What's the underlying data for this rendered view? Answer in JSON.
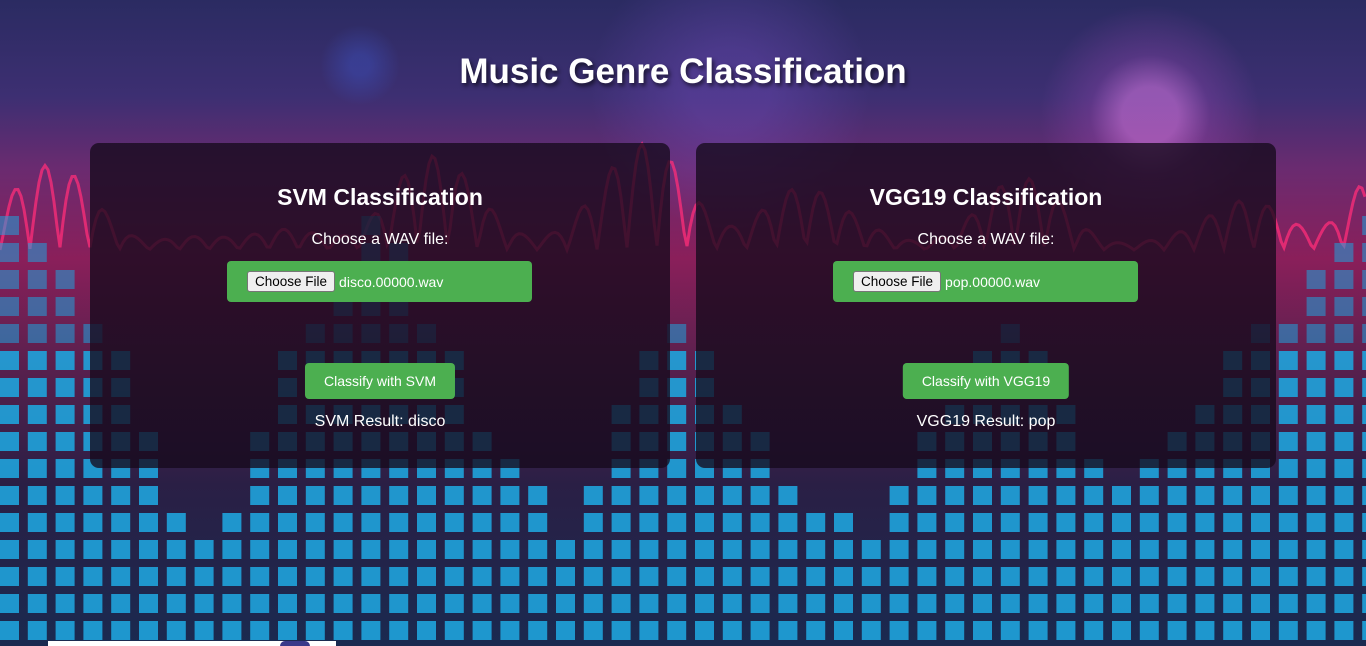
{
  "page": {
    "title": "Music Genre Classification"
  },
  "svm": {
    "heading": "SVM Classification",
    "choose_label": "Choose a WAV file:",
    "file_button": "Choose File",
    "file_name": "disco.00000.wav",
    "classify_button": "Classify with SVM",
    "result": "SVM Result: disco"
  },
  "vgg": {
    "heading": "VGG19 Classification",
    "choose_label": "Choose a WAV file:",
    "file_button": "Choose File",
    "file_name": "pop.00000.wav",
    "classify_button": "Classify with VGG19",
    "result": "VGG19 Result: pop"
  },
  "colors": {
    "accent_green": "#4caf50",
    "panel_bg": "#160a1c",
    "equalizer_cyan": "#1fa3dc",
    "wave_pink": "#ff2d7a"
  },
  "background": {
    "icons": [
      "equalizer-bars",
      "sound-wave"
    ]
  }
}
